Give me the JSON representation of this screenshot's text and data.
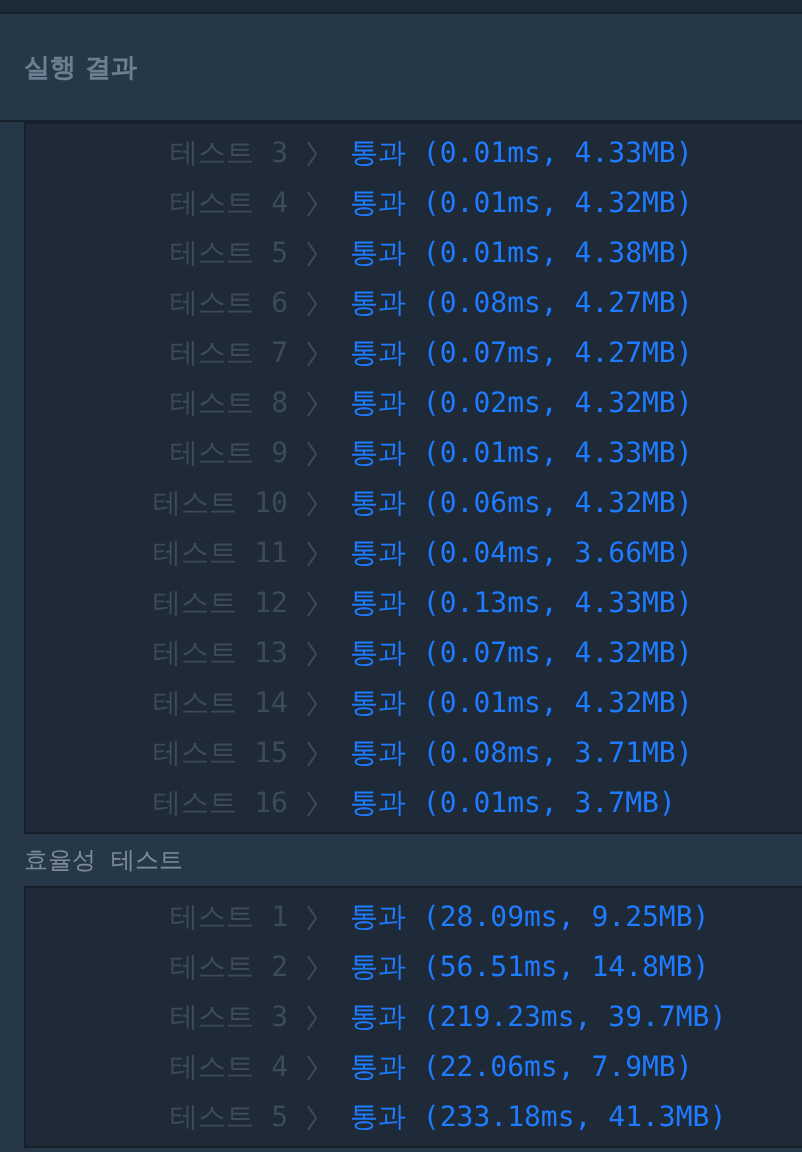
{
  "panel": {
    "title": "실행 결과"
  },
  "sections": [
    {
      "rows": [
        {
          "test": "테스트 3",
          "result": "통과 (0.01ms, 4.33MB)"
        },
        {
          "test": "테스트 4",
          "result": "통과 (0.01ms, 4.32MB)"
        },
        {
          "test": "테스트 5",
          "result": "통과 (0.01ms, 4.38MB)"
        },
        {
          "test": "테스트 6",
          "result": "통과 (0.08ms, 4.27MB)"
        },
        {
          "test": "테스트 7",
          "result": "통과 (0.07ms, 4.27MB)"
        },
        {
          "test": "테스트 8",
          "result": "통과 (0.02ms, 4.32MB)"
        },
        {
          "test": "테스트 9",
          "result": "통과 (0.01ms, 4.33MB)"
        },
        {
          "test": "테스트 10",
          "result": "통과 (0.06ms, 4.32MB)"
        },
        {
          "test": "테스트 11",
          "result": "통과 (0.04ms, 3.66MB)"
        },
        {
          "test": "테스트 12",
          "result": "통과 (0.13ms, 4.33MB)"
        },
        {
          "test": "테스트 13",
          "result": "통과 (0.07ms, 4.32MB)"
        },
        {
          "test": "테스트 14",
          "result": "통과 (0.01ms, 4.32MB)"
        },
        {
          "test": "테스트 15",
          "result": "통과 (0.08ms, 3.71MB)"
        },
        {
          "test": "테스트 16",
          "result": "통과 (0.01ms, 3.7MB)"
        }
      ]
    },
    {
      "label": "효율성  테스트",
      "rows": [
        {
          "test": "테스트 1",
          "result": "통과 (28.09ms, 9.25MB)"
        },
        {
          "test": "테스트 2",
          "result": "통과 (56.51ms, 14.8MB)"
        },
        {
          "test": "테스트 3",
          "result": "통과 (219.23ms, 39.7MB)"
        },
        {
          "test": "테스트 4",
          "result": "통과 (22.06ms, 7.9MB)"
        },
        {
          "test": "테스트 5",
          "result": "통과 (233.18ms, 41.3MB)"
        }
      ]
    }
  ]
}
